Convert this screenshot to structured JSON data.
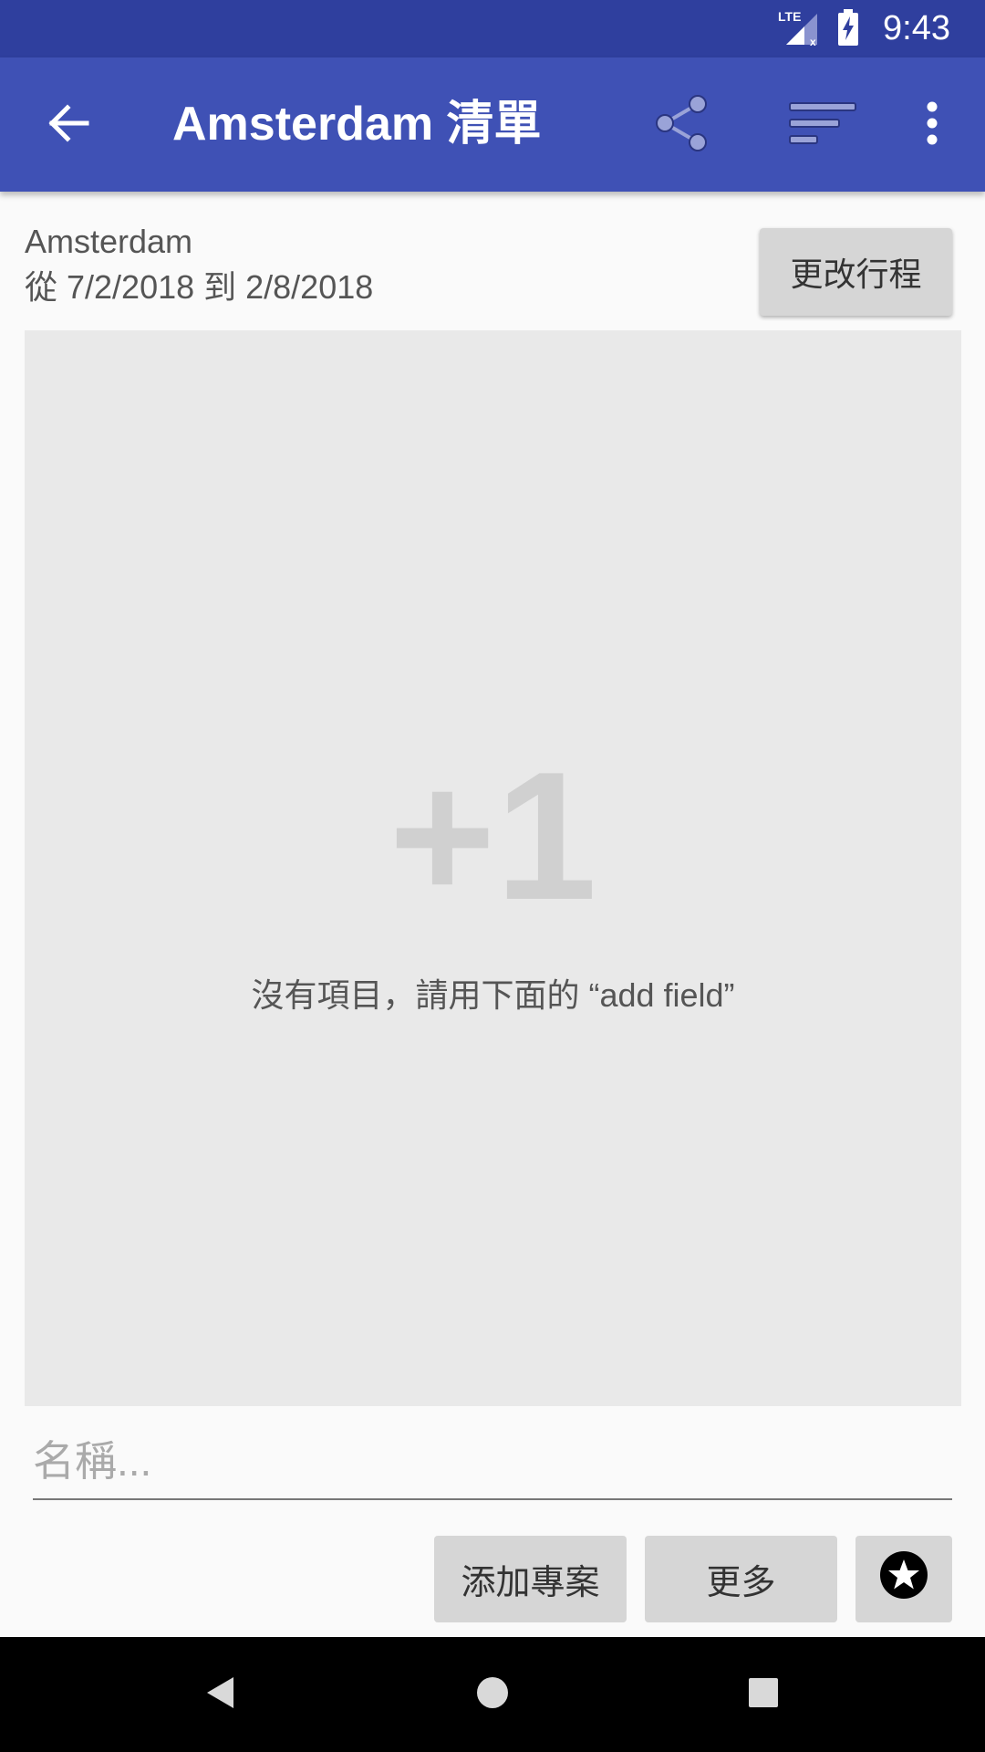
{
  "status_bar": {
    "network_label": "LTE",
    "time": "9:43"
  },
  "app_bar": {
    "title": "Amsterdam 清單",
    "icons": {
      "back": "arrow-back-icon",
      "share": "share-icon",
      "sort": "sort-icon",
      "more": "more-vert-icon"
    }
  },
  "trip": {
    "destination": "Amsterdam",
    "dates": "從 7/2/2018 到 2/8/2018",
    "change_button": "更改行程"
  },
  "empty_state": {
    "big_text": "+1",
    "message": "沒有項目，請用下面的 “add field”"
  },
  "input": {
    "placeholder": "名稱...",
    "value": ""
  },
  "actions": {
    "add_item": "添加專案",
    "more": "更多",
    "favorite_icon": "star-circle-icon"
  },
  "colors": {
    "status_bar": "#2f3f9e",
    "app_bar": "#3f51b5",
    "panel": "#e9e9e9",
    "button": "#d6d6d6"
  }
}
